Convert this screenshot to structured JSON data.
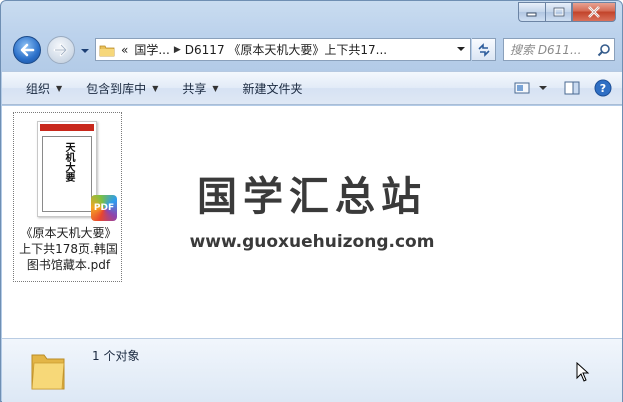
{
  "window": {
    "accent": "#b9d1ea",
    "close_color": "#c8432a"
  },
  "address_bar": {
    "overflow_glyph": "«",
    "parts": [
      "国学...",
      "D6117 《原本天机大要》上下共17..."
    ]
  },
  "search": {
    "placeholder": "搜索 D611..."
  },
  "toolbar": {
    "organize": "组织",
    "include_in_library": "包含到库中",
    "share": "共享",
    "new_folder": "新建文件夹"
  },
  "file": {
    "name_lines": [
      "《原本天机大要》",
      "上下共178页.韩国",
      "图书馆藏本.pdf"
    ],
    "thumbnail_title": "天机大要",
    "badge": "PDF"
  },
  "watermark": {
    "title": "国学汇总站",
    "url": "www.guoxuehuizong.com"
  },
  "details": {
    "count_text": "1 个对象"
  }
}
